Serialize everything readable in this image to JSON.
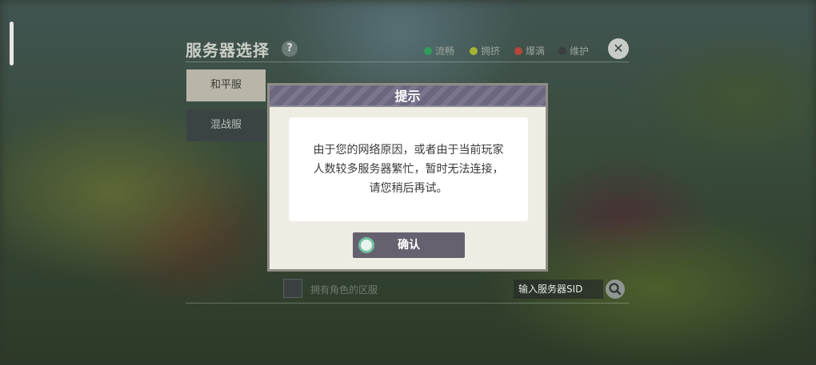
{
  "panel": {
    "title": "服务器选择",
    "help_icon": "?",
    "legend": [
      {
        "label": "流畅",
        "color": "#2f9e5a"
      },
      {
        "label": "拥挤",
        "color": "#a5b234"
      },
      {
        "label": "爆满",
        "color": "#b8453a"
      },
      {
        "label": "维护",
        "color": "#3a3f42"
      }
    ],
    "close_icon": "close-icon",
    "tabs": [
      {
        "label": "和平服",
        "selected": true
      },
      {
        "label": "混战服",
        "selected": false
      }
    ],
    "has_role_label": "拥有角色的区服",
    "sid_placeholder": "输入服务器SID",
    "search_icon": "search-icon"
  },
  "dialog": {
    "title": "提示",
    "message": "由于您的网络原因，或者由于当前玩家人数较多服务器繁忙，暂时无法连接，请您稍后再试。",
    "confirm_label": "确认",
    "accent": "#6c6680"
  }
}
